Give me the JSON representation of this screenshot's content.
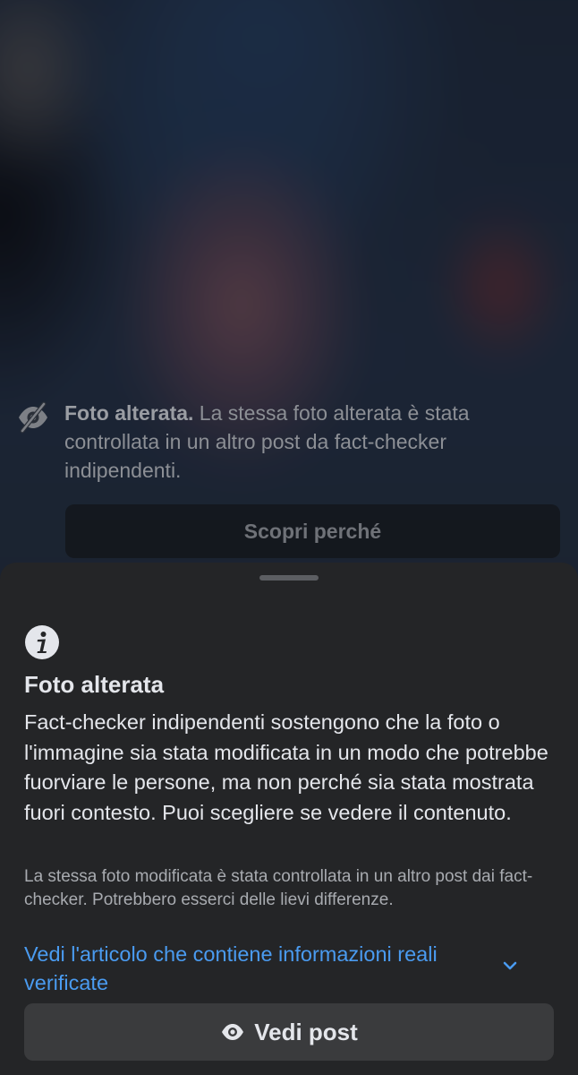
{
  "warning": {
    "icon": "eye-slash-icon",
    "title": "Foto alterata.",
    "text": " La stessa foto alterata è stata controllata in un altro post da fact-checker indipendenti.",
    "button_label": "Scopri perché"
  },
  "sheet": {
    "icon": "info-icon",
    "title": "Foto alterata",
    "body": "Fact-checker indipendenti sostengono che la foto o l'immagine sia stata modificata in un modo che potrebbe fuorviare le persone, ma non perché sia stata mostrata fuori contesto. Puoi scegliere se vedere il contenuto.",
    "note": "La stessa foto modificata è stata controllata in un altro post dai fact-checker. Potrebbero esserci delle lievi differenze.",
    "article_link": "Vedi l'articolo che contiene informazioni reali verificate",
    "view_button": {
      "icon": "eye-icon",
      "label": "Vedi post"
    }
  },
  "colors": {
    "sheet_background": "#242527",
    "link": "#4a9bf0",
    "primary_text": "#e4e6eb",
    "button_background": "#3a3b3d"
  }
}
